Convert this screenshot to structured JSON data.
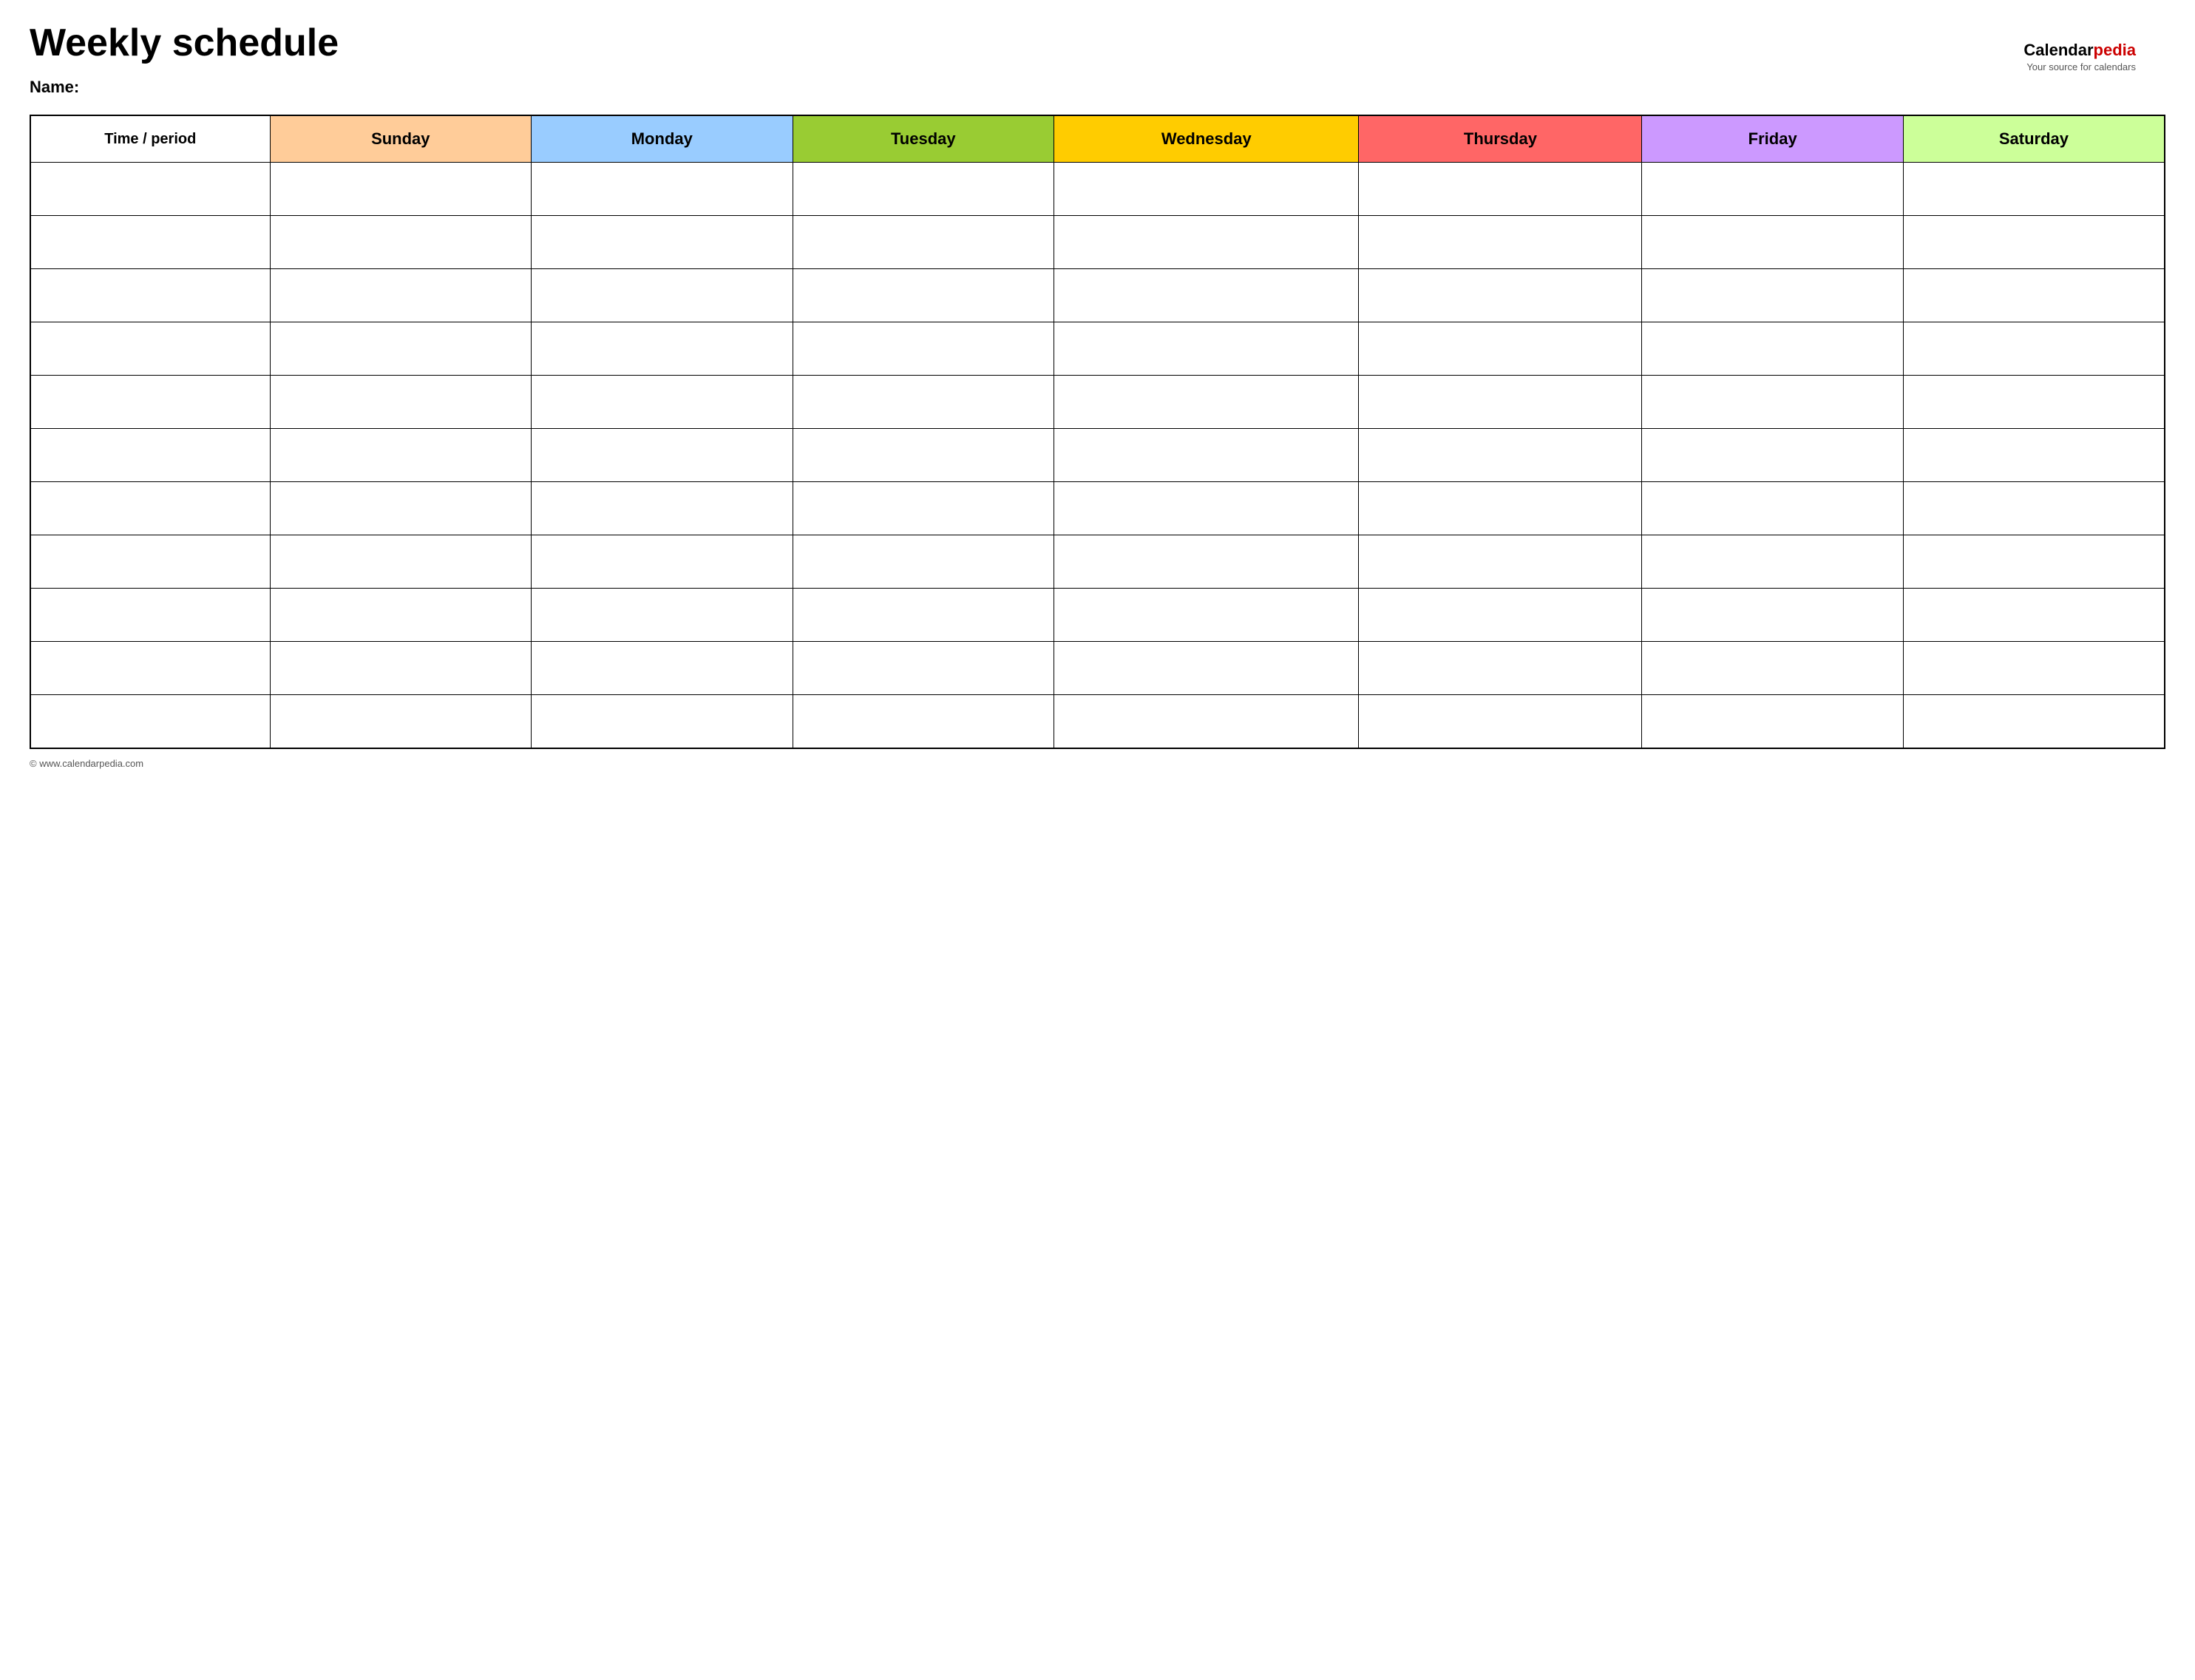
{
  "title": "Weekly schedule",
  "name_label": "Name:",
  "logo": {
    "calendar": "Calendar",
    "pedia": "pedia",
    "tagline": "Your source for calendars"
  },
  "footer": {
    "url": "© www.calendarpedia.com"
  },
  "table": {
    "headers": [
      {
        "id": "time",
        "label": "Time / period",
        "color": "#ffffff",
        "class": "header-time"
      },
      {
        "id": "sunday",
        "label": "Sunday",
        "color": "#ffcc99",
        "class": "header-sunday"
      },
      {
        "id": "monday",
        "label": "Monday",
        "color": "#99ccff",
        "class": "header-monday"
      },
      {
        "id": "tuesday",
        "label": "Tuesday",
        "color": "#99cc33",
        "class": "header-tuesday"
      },
      {
        "id": "wednesday",
        "label": "Wednesday",
        "color": "#ffcc00",
        "class": "header-wednesday"
      },
      {
        "id": "thursday",
        "label": "Thursday",
        "color": "#ff6666",
        "class": "header-thursday"
      },
      {
        "id": "friday",
        "label": "Friday",
        "color": "#cc99ff",
        "class": "header-friday"
      },
      {
        "id": "saturday",
        "label": "Saturday",
        "color": "#ccff99",
        "class": "header-saturday"
      }
    ],
    "row_count": 11
  }
}
